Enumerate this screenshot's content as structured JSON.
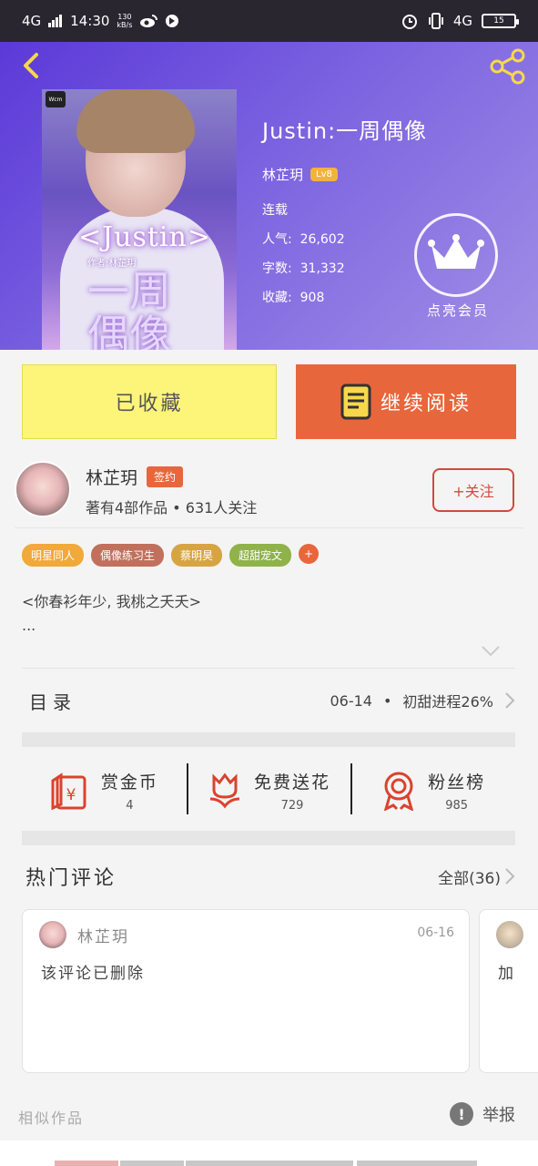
{
  "status_bar": {
    "network": "4G",
    "time": "14:30",
    "speed_value": "130",
    "speed_unit": "kB/s",
    "network_right": "4G",
    "battery": "15"
  },
  "book": {
    "title": "Justin:一周偶像",
    "author": "林芷玥",
    "level": "Lv8",
    "status": "连载",
    "popularity_label": "人气:",
    "popularity": "26,602",
    "wordcount_label": "字数:",
    "wordcount": "31,332",
    "favorites_label": "收藏:",
    "favorites": "908",
    "cover_logo": "Wcm",
    "cover_title": "<Justin>",
    "cover_author": "作者:林芷玥",
    "cover_big": "一周\n偶像"
  },
  "vip": {
    "label": "点亮会员"
  },
  "actions": {
    "favorited": "已收藏",
    "continue_reading": "继续阅读"
  },
  "author_card": {
    "name": "林芷玥",
    "badge": "签约",
    "meta": "著有4部作品 • 631人关注",
    "follow": "+关注"
  },
  "tags": [
    {
      "label": "明星同人",
      "color": "#f0a93a"
    },
    {
      "label": "偶像练习生",
      "color": "#c0705c"
    },
    {
      "label": "蔡明昊",
      "color": "#d7a444"
    },
    {
      "label": "超甜宠文",
      "color": "#8fb24a"
    }
  ],
  "tag_more": "+",
  "description": {
    "line1": "<你春衫年少, 我桃之夭夭>",
    "line2": "..."
  },
  "toc": {
    "label": "目录",
    "date": "06-14",
    "sep": "•",
    "latest": "初甜进程26%"
  },
  "stats": [
    {
      "label": "赏金币",
      "value": "4"
    },
    {
      "label": "免费送花",
      "value": "729"
    },
    {
      "label": "粉丝榜",
      "value": "985"
    }
  ],
  "comments": {
    "title": "热门评论",
    "all": "全部(36)",
    "items": [
      {
        "user": "林芷玥",
        "date": "06-16",
        "text": "该评论已删除"
      },
      {
        "user": "",
        "date": "",
        "text": "加"
      }
    ]
  },
  "footer": {
    "similar": "相似作品",
    "report": "举报"
  },
  "colors": {
    "accent": "#e8663c",
    "hero_start": "#5b39d8",
    "favorite_yellow": "#fdf47a"
  }
}
